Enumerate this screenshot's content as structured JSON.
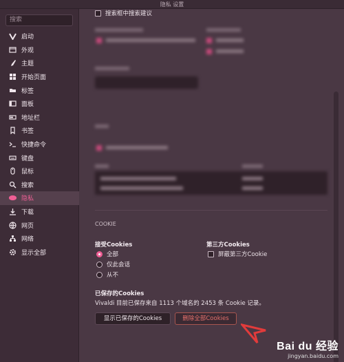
{
  "window": {
    "title": "隐私 设置"
  },
  "sidebar": {
    "search_placeholder": "搜索",
    "items": [
      {
        "label": "启动",
        "icon": "vivaldi-logo-icon"
      },
      {
        "label": "外观",
        "icon": "window-icon"
      },
      {
        "label": "主题",
        "icon": "brush-icon"
      },
      {
        "label": "开始页面",
        "icon": "grid-icon"
      },
      {
        "label": "标签",
        "icon": "tabs-icon"
      },
      {
        "label": "面板",
        "icon": "panel-icon"
      },
      {
        "label": "地址栏",
        "icon": "address-bar-icon"
      },
      {
        "label": "书签",
        "icon": "bookmark-icon"
      },
      {
        "label": "快捷命令",
        "icon": "command-prompt-icon"
      },
      {
        "label": "键盘",
        "icon": "keyboard-icon"
      },
      {
        "label": "鼠标",
        "icon": "mouse-icon"
      },
      {
        "label": "搜索",
        "icon": "search-icon"
      },
      {
        "label": "隐私",
        "icon": "eye-icon",
        "active": true
      },
      {
        "label": "下载",
        "icon": "download-icon"
      },
      {
        "label": "网页",
        "icon": "globe-icon"
      },
      {
        "label": "网络",
        "icon": "network-icon"
      },
      {
        "label": "显示全部",
        "icon": "gear-icon"
      }
    ]
  },
  "content": {
    "top_option": "搜索框中搜索建议",
    "cookies": {
      "section_title": "COOKIE",
      "accept_title": "接受Cookies",
      "accept_options": [
        {
          "label": "全部",
          "checked": true
        },
        {
          "label": "仅此会话",
          "checked": false
        },
        {
          "label": "从不",
          "checked": false
        }
      ],
      "third_party_title": "第三方Cookies",
      "third_party_option": "屏蔽第三方Cookie",
      "saved_title": "已保存的Cookies",
      "saved_info": "Vivaldi 目前已保存来自 1113 个域名的 2453 条 Cookie 记录。",
      "show_button": "显示已保存的Cookies",
      "delete_button": "删除全部Cookies"
    }
  },
  "watermark": {
    "logo": "Bai du 经验",
    "url": "jingyan.baidu.com"
  },
  "colors": {
    "accent": "#ef5f95",
    "danger": "#e4706b",
    "background": "#4a3844"
  }
}
